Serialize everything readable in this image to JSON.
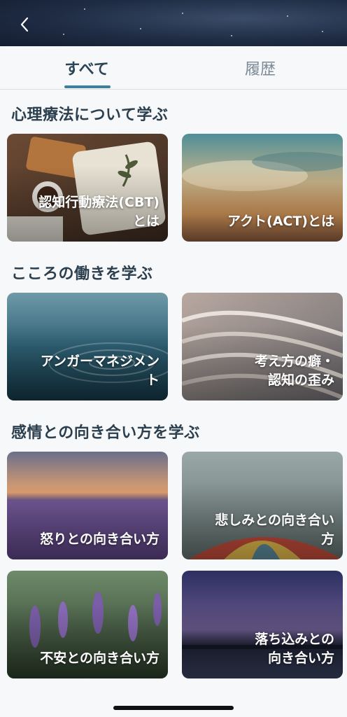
{
  "header": {
    "back_icon": "chevron-left-icon"
  },
  "tabs": [
    {
      "label": "すべて",
      "active": true
    },
    {
      "label": "履歴",
      "active": false
    }
  ],
  "sections": [
    {
      "title": "心理療法について学ぶ",
      "cards": [
        {
          "label": "認知行動療法(CBT)\nとは"
        },
        {
          "label": "アクト(ACT)とは"
        }
      ]
    },
    {
      "title": "こころの働きを学ぶ",
      "cards": [
        {
          "label": "アンガーマネジメン\nト"
        },
        {
          "label": "考え方の癖・\n認知の歪み"
        }
      ]
    },
    {
      "title": "感情との向き合い方を学ぶ",
      "cards": [
        {
          "label": "怒りとの向き合い方"
        },
        {
          "label": "悲しみとの向き合い\n方"
        },
        {
          "label": "不安との向き合い方"
        },
        {
          "label": "落ち込みとの\n向き合い方"
        }
      ]
    }
  ],
  "colors": {
    "accent": "#3f7f97",
    "title": "#2b3f4e",
    "background": "#f7f8fa"
  }
}
